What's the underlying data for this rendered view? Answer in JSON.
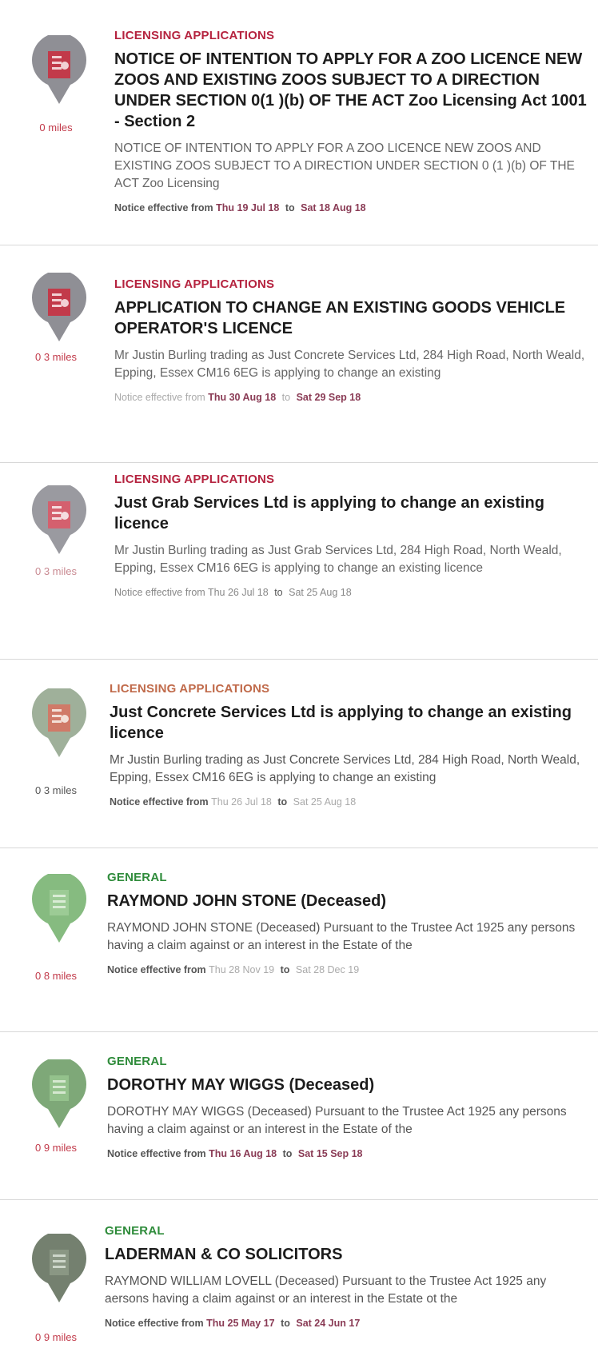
{
  "colors": {
    "licensing": "#b5233f",
    "general": "#2e8b3a",
    "pin_red_body": "#8f8f95",
    "pin_green_body": "#7fb47a"
  },
  "items": [
    {
      "category": "LICENSING APPLICATIONS",
      "title": "NOTICE OF INTENTION TO APPLY FOR A ZOO LICENCE NEW ZOOS AND EXISTING ZOOS SUBJECT TO A DIRECTION UNDER SECTION 0(1 )(b) OF THE ACT Zoo Licensing Act 1001 - Section 2",
      "description": "NOTICE OF INTENTION TO APPLY FOR A ZOO LICENCE NEW ZOOS AND EXISTING ZOOS SUBJECT TO A DIRECTION UNDER SECTION 0 (1 )(b) OF THE ACT Zoo Licensing",
      "distance": "0 miles",
      "effective_label": "Notice effective from",
      "from": "Thu 19 Jul 18",
      "to_label": "to",
      "to": "Sat 18 Aug 18",
      "icon": "licence-document-icon"
    },
    {
      "category": "LICENSING APPLICATIONS",
      "title": "APPLICATION TO CHANGE AN EXISTING GOODS VEHICLE OPERATOR'S LICENCE",
      "description": "Mr Justin Burling trading as Just Concrete Services Ltd, 284 High Road, North Weald, Epping, Essex  CM16 6EG is applying to change an existing",
      "distance": "0 3 miles",
      "effective_label": "Notice effective from",
      "from": "Thu 30 Aug 18",
      "to_label": "to",
      "to": "Sat 29 Sep 18",
      "icon": "licence-document-icon"
    },
    {
      "category": "LICENSING APPLICATIONS",
      "title": "Just Grab Services Ltd is applying to change an existing licence",
      "description": "Mr Justin Burling trading as Just Grab Services Ltd, 284 High Road, North Weald, Epping, Essex  CM16 6EG is applying to change an existing licence",
      "distance": "0 3 miles",
      "effective_label": "Notice effective from",
      "from": "Thu 26 Jul 18",
      "to_label": "to",
      "to": "Sat 25 Aug 18",
      "icon": "licence-document-icon"
    },
    {
      "category": "LICENSING APPLICATIONS",
      "title": "Just Concrete Services Ltd is applying to change an existing licence",
      "description": "Mr Justin Burling trading as Just Concrete Services Ltd, 284 High Road, North Weald, Epping, Essex  CM16 6EG is applying to change an existing",
      "distance": "0 3 miles",
      "effective_label": "Notice effective from",
      "from": "Thu 26 Jul 18",
      "to_label": "to",
      "to": "Sat 25 Aug 18",
      "icon": "licence-document-icon"
    },
    {
      "category": "GENERAL",
      "title": "RAYMOND JOHN STONE (Deceased)",
      "description": "RAYMOND JOHN STONE (Deceased) Pursuant to the Trustee Act 1925 any persons having a claim against or an interest in the Estate of the",
      "distance": "0 8 miles",
      "effective_label": "Notice effective from",
      "from": "Thu 28 Nov 19",
      "to_label": "to",
      "to": "Sat 28 Dec 19",
      "icon": "document-list-icon"
    },
    {
      "category": "GENERAL",
      "title": "DOROTHY MAY WIGGS (Deceased)",
      "description": "DOROTHY MAY WIGGS (Deceased) Pursuant to the Trustee Act 1925 any persons having a claim against or an interest in the Estate of the",
      "distance": "0 9 miles",
      "effective_label": "Notice effective from",
      "from": "Thu 16 Aug 18",
      "to_label": "to",
      "to": "Sat 15 Sep 18",
      "icon": "document-list-icon"
    },
    {
      "category": "GENERAL",
      "title": "LADERMAN & CO SOLICITORS",
      "description": "RAYMOND WILLIAM LOVELL (Deceased) Pursuant to the Trustee Act 1925 any aersons having a claim against or an interest in the Estate ot the",
      "distance": "0 9 miles",
      "effective_label": "Notice effective from",
      "from": "Thu 25 May 17",
      "to_label": "to",
      "to": "Sat 24 Jun 17",
      "icon": "document-list-icon"
    }
  ]
}
